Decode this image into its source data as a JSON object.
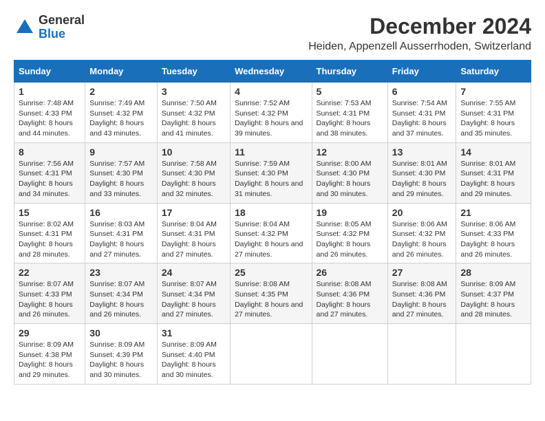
{
  "logo": {
    "general": "General",
    "blue": "Blue"
  },
  "title": "December 2024",
  "location": "Heiden, Appenzell Ausserrhoden, Switzerland",
  "weekdays": [
    "Sunday",
    "Monday",
    "Tuesday",
    "Wednesday",
    "Thursday",
    "Friday",
    "Saturday"
  ],
  "weeks": [
    [
      {
        "day": "1",
        "sunrise": "7:48 AM",
        "sunset": "4:33 PM",
        "daylight": "8 hours and 44 minutes."
      },
      {
        "day": "2",
        "sunrise": "7:49 AM",
        "sunset": "4:32 PM",
        "daylight": "8 hours and 43 minutes."
      },
      {
        "day": "3",
        "sunrise": "7:50 AM",
        "sunset": "4:32 PM",
        "daylight": "8 hours and 41 minutes."
      },
      {
        "day": "4",
        "sunrise": "7:52 AM",
        "sunset": "4:32 PM",
        "daylight": "8 hours and 39 minutes."
      },
      {
        "day": "5",
        "sunrise": "7:53 AM",
        "sunset": "4:31 PM",
        "daylight": "8 hours and 38 minutes."
      },
      {
        "day": "6",
        "sunrise": "7:54 AM",
        "sunset": "4:31 PM",
        "daylight": "8 hours and 37 minutes."
      },
      {
        "day": "7",
        "sunrise": "7:55 AM",
        "sunset": "4:31 PM",
        "daylight": "8 hours and 35 minutes."
      }
    ],
    [
      {
        "day": "8",
        "sunrise": "7:56 AM",
        "sunset": "4:31 PM",
        "daylight": "8 hours and 34 minutes."
      },
      {
        "day": "9",
        "sunrise": "7:57 AM",
        "sunset": "4:30 PM",
        "daylight": "8 hours and 33 minutes."
      },
      {
        "day": "10",
        "sunrise": "7:58 AM",
        "sunset": "4:30 PM",
        "daylight": "8 hours and 32 minutes."
      },
      {
        "day": "11",
        "sunrise": "7:59 AM",
        "sunset": "4:30 PM",
        "daylight": "8 hours and 31 minutes."
      },
      {
        "day": "12",
        "sunrise": "8:00 AM",
        "sunset": "4:30 PM",
        "daylight": "8 hours and 30 minutes."
      },
      {
        "day": "13",
        "sunrise": "8:01 AM",
        "sunset": "4:30 PM",
        "daylight": "8 hours and 29 minutes."
      },
      {
        "day": "14",
        "sunrise": "8:01 AM",
        "sunset": "4:31 PM",
        "daylight": "8 hours and 29 minutes."
      }
    ],
    [
      {
        "day": "15",
        "sunrise": "8:02 AM",
        "sunset": "4:31 PM",
        "daylight": "8 hours and 28 minutes."
      },
      {
        "day": "16",
        "sunrise": "8:03 AM",
        "sunset": "4:31 PM",
        "daylight": "8 hours and 27 minutes."
      },
      {
        "day": "17",
        "sunrise": "8:04 AM",
        "sunset": "4:31 PM",
        "daylight": "8 hours and 27 minutes."
      },
      {
        "day": "18",
        "sunrise": "8:04 AM",
        "sunset": "4:32 PM",
        "daylight": "8 hours and 27 minutes."
      },
      {
        "day": "19",
        "sunrise": "8:05 AM",
        "sunset": "4:32 PM",
        "daylight": "8 hours and 26 minutes."
      },
      {
        "day": "20",
        "sunrise": "8:06 AM",
        "sunset": "4:32 PM",
        "daylight": "8 hours and 26 minutes."
      },
      {
        "day": "21",
        "sunrise": "8:06 AM",
        "sunset": "4:33 PM",
        "daylight": "8 hours and 26 minutes."
      }
    ],
    [
      {
        "day": "22",
        "sunrise": "8:07 AM",
        "sunset": "4:33 PM",
        "daylight": "8 hours and 26 minutes."
      },
      {
        "day": "23",
        "sunrise": "8:07 AM",
        "sunset": "4:34 PM",
        "daylight": "8 hours and 26 minutes."
      },
      {
        "day": "24",
        "sunrise": "8:07 AM",
        "sunset": "4:34 PM",
        "daylight": "8 hours and 27 minutes."
      },
      {
        "day": "25",
        "sunrise": "8:08 AM",
        "sunset": "4:35 PM",
        "daylight": "8 hours and 27 minutes."
      },
      {
        "day": "26",
        "sunrise": "8:08 AM",
        "sunset": "4:36 PM",
        "daylight": "8 hours and 27 minutes."
      },
      {
        "day": "27",
        "sunrise": "8:08 AM",
        "sunset": "4:36 PM",
        "daylight": "8 hours and 27 minutes."
      },
      {
        "day": "28",
        "sunrise": "8:09 AM",
        "sunset": "4:37 PM",
        "daylight": "8 hours and 28 minutes."
      }
    ],
    [
      {
        "day": "29",
        "sunrise": "8:09 AM",
        "sunset": "4:38 PM",
        "daylight": "8 hours and 29 minutes."
      },
      {
        "day": "30",
        "sunrise": "8:09 AM",
        "sunset": "4:39 PM",
        "daylight": "8 hours and 30 minutes."
      },
      {
        "day": "31",
        "sunrise": "8:09 AM",
        "sunset": "4:40 PM",
        "daylight": "8 hours and 30 minutes."
      },
      null,
      null,
      null,
      null
    ]
  ]
}
